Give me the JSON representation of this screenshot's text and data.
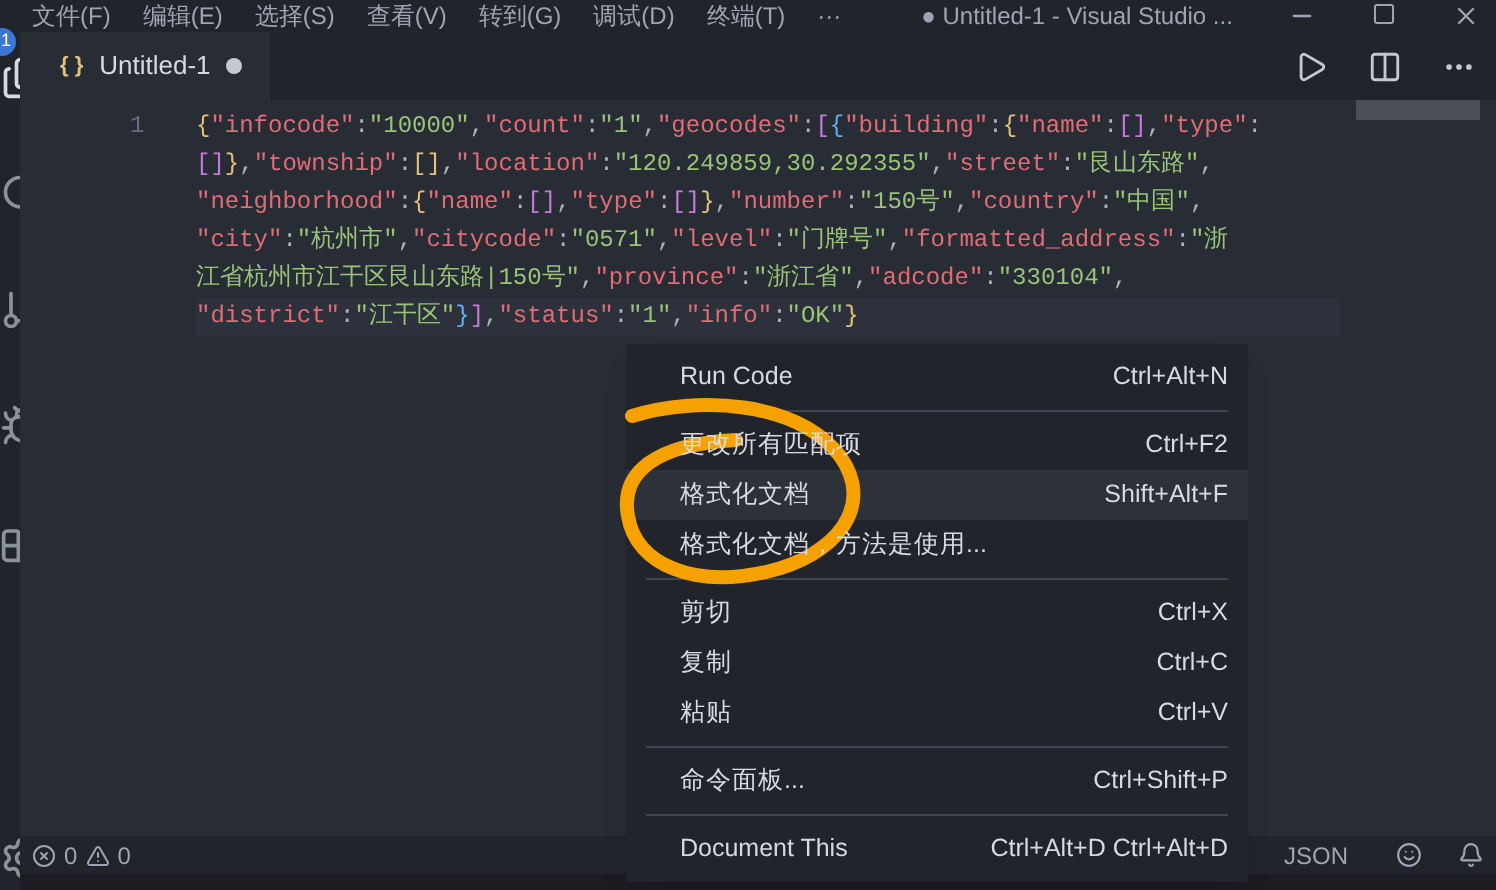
{
  "menu_bar": {
    "items": [
      "文件(F)",
      "编辑(E)",
      "选择(S)",
      "查看(V)",
      "转到(G)",
      "调试(D)",
      "终端(T)",
      "···"
    ],
    "title": "● Untitled-1 - Visual Studio ..."
  },
  "activity_bar": {
    "badge": "1"
  },
  "tabs": [
    {
      "icon_text": "{ }",
      "label": "Untitled-1",
      "modified": true,
      "selected": true
    }
  ],
  "editor": {
    "lines": [
      {
        "number": "1",
        "wrapped": [
          "{\"infocode\":\"10000\",\"count\":\"1\",\"geocodes\":[{\"building\":{\"name\":[],\"type\":",
          "[]},\"township\":[],\"location\":\"120.249859,30.292355\",\"street\":\"艮山东路\",",
          "\"neighborhood\":{\"name\":[],\"type\":[]},\"number\":\"150号\",\"country\":\"中国\",",
          "\"city\":\"杭州市\",\"citycode\":\"0571\",\"level\":\"门牌号\",\"formatted_address\":\"浙",
          "江省杭州市江干区艮山东路|150号\",\"province\":\"浙江省\",\"adcode\":\"330104\",",
          "\"district\":\"江干区\"}],\"status\":\"1\",\"info\":\"OK\"}"
        ]
      }
    ]
  },
  "context_menu": {
    "groups": [
      [
        {
          "label": "Run Code",
          "shortcut": "Ctrl+Alt+N",
          "selected": false
        }
      ],
      [
        {
          "label": "更改所有匹配项",
          "shortcut": "Ctrl+F2",
          "selected": false
        },
        {
          "label": "格式化文档",
          "shortcut": "Shift+Alt+F",
          "selected": true
        },
        {
          "label": "格式化文档，方法是使用...",
          "selected": false
        }
      ],
      [
        {
          "label": "剪切",
          "shortcut": "Ctrl+X",
          "selected": false
        },
        {
          "label": "复制",
          "shortcut": "Ctrl+C",
          "selected": false
        },
        {
          "label": "粘贴",
          "shortcut": "Ctrl+V",
          "selected": false
        }
      ],
      [
        {
          "label": "命令面板...",
          "shortcut": "Ctrl+Shift+P",
          "selected": false
        }
      ],
      [
        {
          "label": "Document This",
          "shortcut": "Ctrl+Alt+D Ctrl+Alt+D",
          "selected": false
        }
      ]
    ]
  },
  "status_bar": {
    "errors": "0",
    "warnings": "0",
    "language": "JSON"
  }
}
